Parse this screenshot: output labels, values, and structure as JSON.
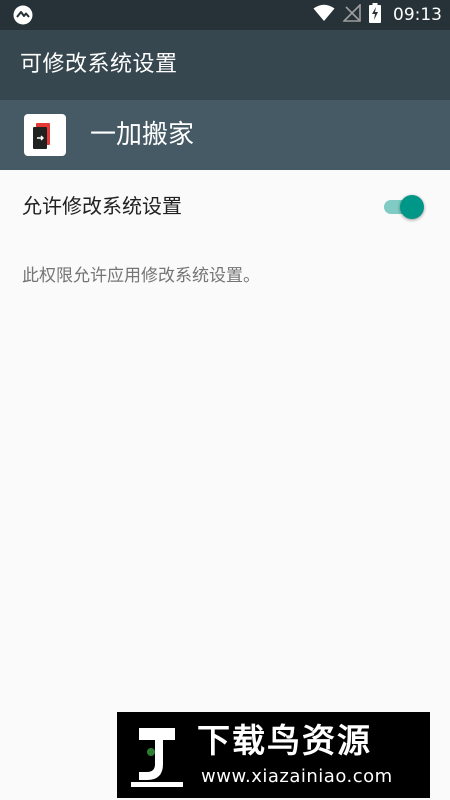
{
  "status_bar": {
    "time": "09:13",
    "left_icon": "notification-logo-icon",
    "icons": [
      "wifi-icon",
      "no-signal-icon",
      "battery-charging-icon"
    ]
  },
  "app_bar": {
    "title": "可修改系统设置"
  },
  "app_header": {
    "app_name": "一加搬家",
    "icon": "app-icon"
  },
  "setting": {
    "label": "允许修改系统设置",
    "toggle_on": true,
    "description": "此权限允许应用修改系统设置。"
  },
  "watermark": {
    "title": "下载鸟资源",
    "url": "www.xiazainiao.com"
  },
  "colors": {
    "status_bar": "#263238",
    "app_bar": "#37474f",
    "header": "#455a64",
    "accent": "#009688",
    "accent_track": "#80cbc4",
    "background": "#fafafa"
  }
}
